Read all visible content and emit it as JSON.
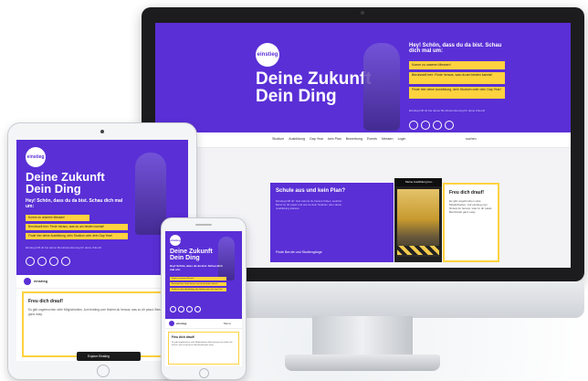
{
  "brand": {
    "logo_text": "einstieg",
    "accent": "#5a2fd6",
    "highlight": "#ffd23f"
  },
  "hero": {
    "title": "Deine Zukunft\nDein Ding",
    "greeting": "Hey! Schön, dass du da bist. Schau dich mal um:",
    "options": [
      "Komm zu unseren Messen!",
      "Berufswelt leer: Finde heraus, was du am besten kannst!",
      "Finde hier deine Ausbildung, dein Studium oder dein Gap Year!"
    ],
    "small_text": "Einstieg hilft dir bei deiner Berufsorientierung für deine Zukunft",
    "social_icons": [
      "instagram-icon",
      "youtube-icon",
      "facebook-icon",
      "tiktok-icon"
    ]
  },
  "nav": {
    "items": [
      "Studium",
      "Ausbildung",
      "Gap Year",
      "kein Plan",
      "Bewerbung",
      "Events",
      "Messen",
      "Login"
    ],
    "right": "suchen"
  },
  "main_card": {
    "title": "Schule aus und kein Plan?",
    "text": "Einstieg hilft dir: Hier kannst du heraus finden, welcher Beruf zu dir passt und wie du dein Studium oder deine Ausbildung startest.",
    "link": "Finde Berufe und Studiengänge"
  },
  "video": {
    "label": "Meine Ausbildung bei...",
    "pill_label": "Explore Einstieg"
  },
  "side_card": {
    "title": "Freu dich drauf!",
    "text": "Es gibt ungebrochen viele Möglichkeiten. Auf einstieg.com findest du heraus, was zu dir passt. Berufswelt ganz easy."
  },
  "phone": {
    "menu": "Menü"
  }
}
